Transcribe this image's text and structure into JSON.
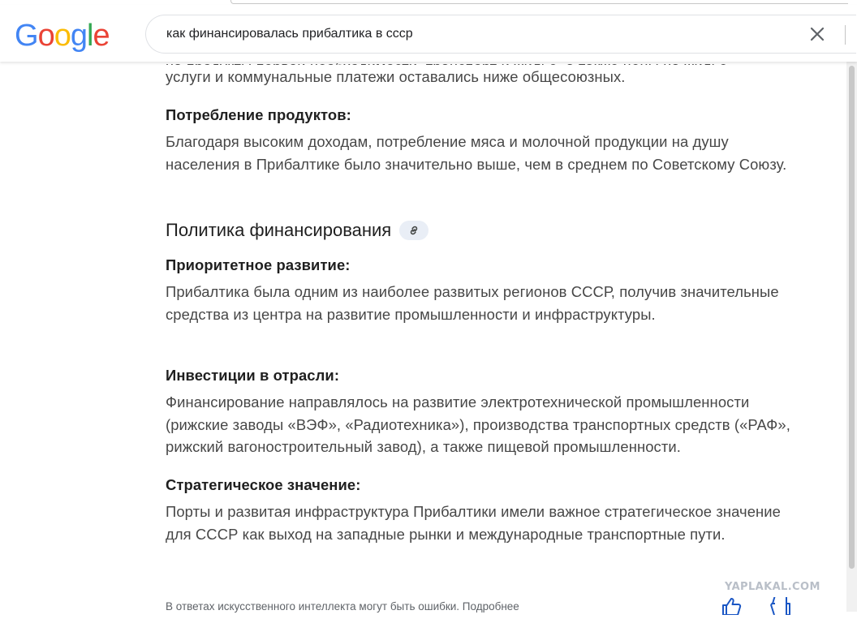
{
  "logo": {
    "letters": [
      "G",
      "o",
      "o",
      "g",
      "l",
      "e"
    ],
    "colors": [
      "#4285F4",
      "#EA4335",
      "#FBBC05",
      "#4285F4",
      "#34A853",
      "#EA4335"
    ]
  },
  "search": {
    "query": "как финансировалась прибалтика в ссср",
    "clear_icon": "close-icon"
  },
  "content": {
    "cut_line": "на продукты первой необходимости, транспорт и жильё, а также цены на жильё,",
    "intro_tail": "услуги и коммунальные платежи оставались ниже общесоюзных.",
    "consumption": {
      "heading": "Потребление продуктов:",
      "text": "Благодаря высоким доходам, потребление мяса и молочной продукции на душу населения в Прибалтике было значительно выше, чем в среднем по Советскому Союзу."
    },
    "section": {
      "title": "Политика финансирования",
      "link_icon": "link-icon"
    },
    "items": [
      {
        "heading": "Приоритетное развитие:",
        "text": "Прибалтика была одним из наиболее развитых регионов СССР, получив значительные средства из центра на развитие промышленности и инфраструктуры."
      },
      {
        "heading": "Инвестиции в отрасли:",
        "text": "Финансирование направлялось на развитие электротехнической промышленности (рижские заводы «ВЭФ», «Радиотехника»), производства транспортных средств («РАФ», рижский вагоностроительный завод), а также пищевой промышленности."
      },
      {
        "heading": "Стратегическое значение:",
        "text": "Порты и развитая инфраструктура Прибалтики имели важное стратегическое значение для СССР как выход на западные рынки и международные транспортные пути."
      }
    ],
    "disclaimer": "В ответах искусственного интеллекта могут быть ошибки. Подробнее"
  },
  "footer": {
    "watermark": "YAPLAKAL.COM",
    "thumb_up_icon": "thumb-up-icon",
    "thumb_down_icon": "thumb-down-icon"
  }
}
